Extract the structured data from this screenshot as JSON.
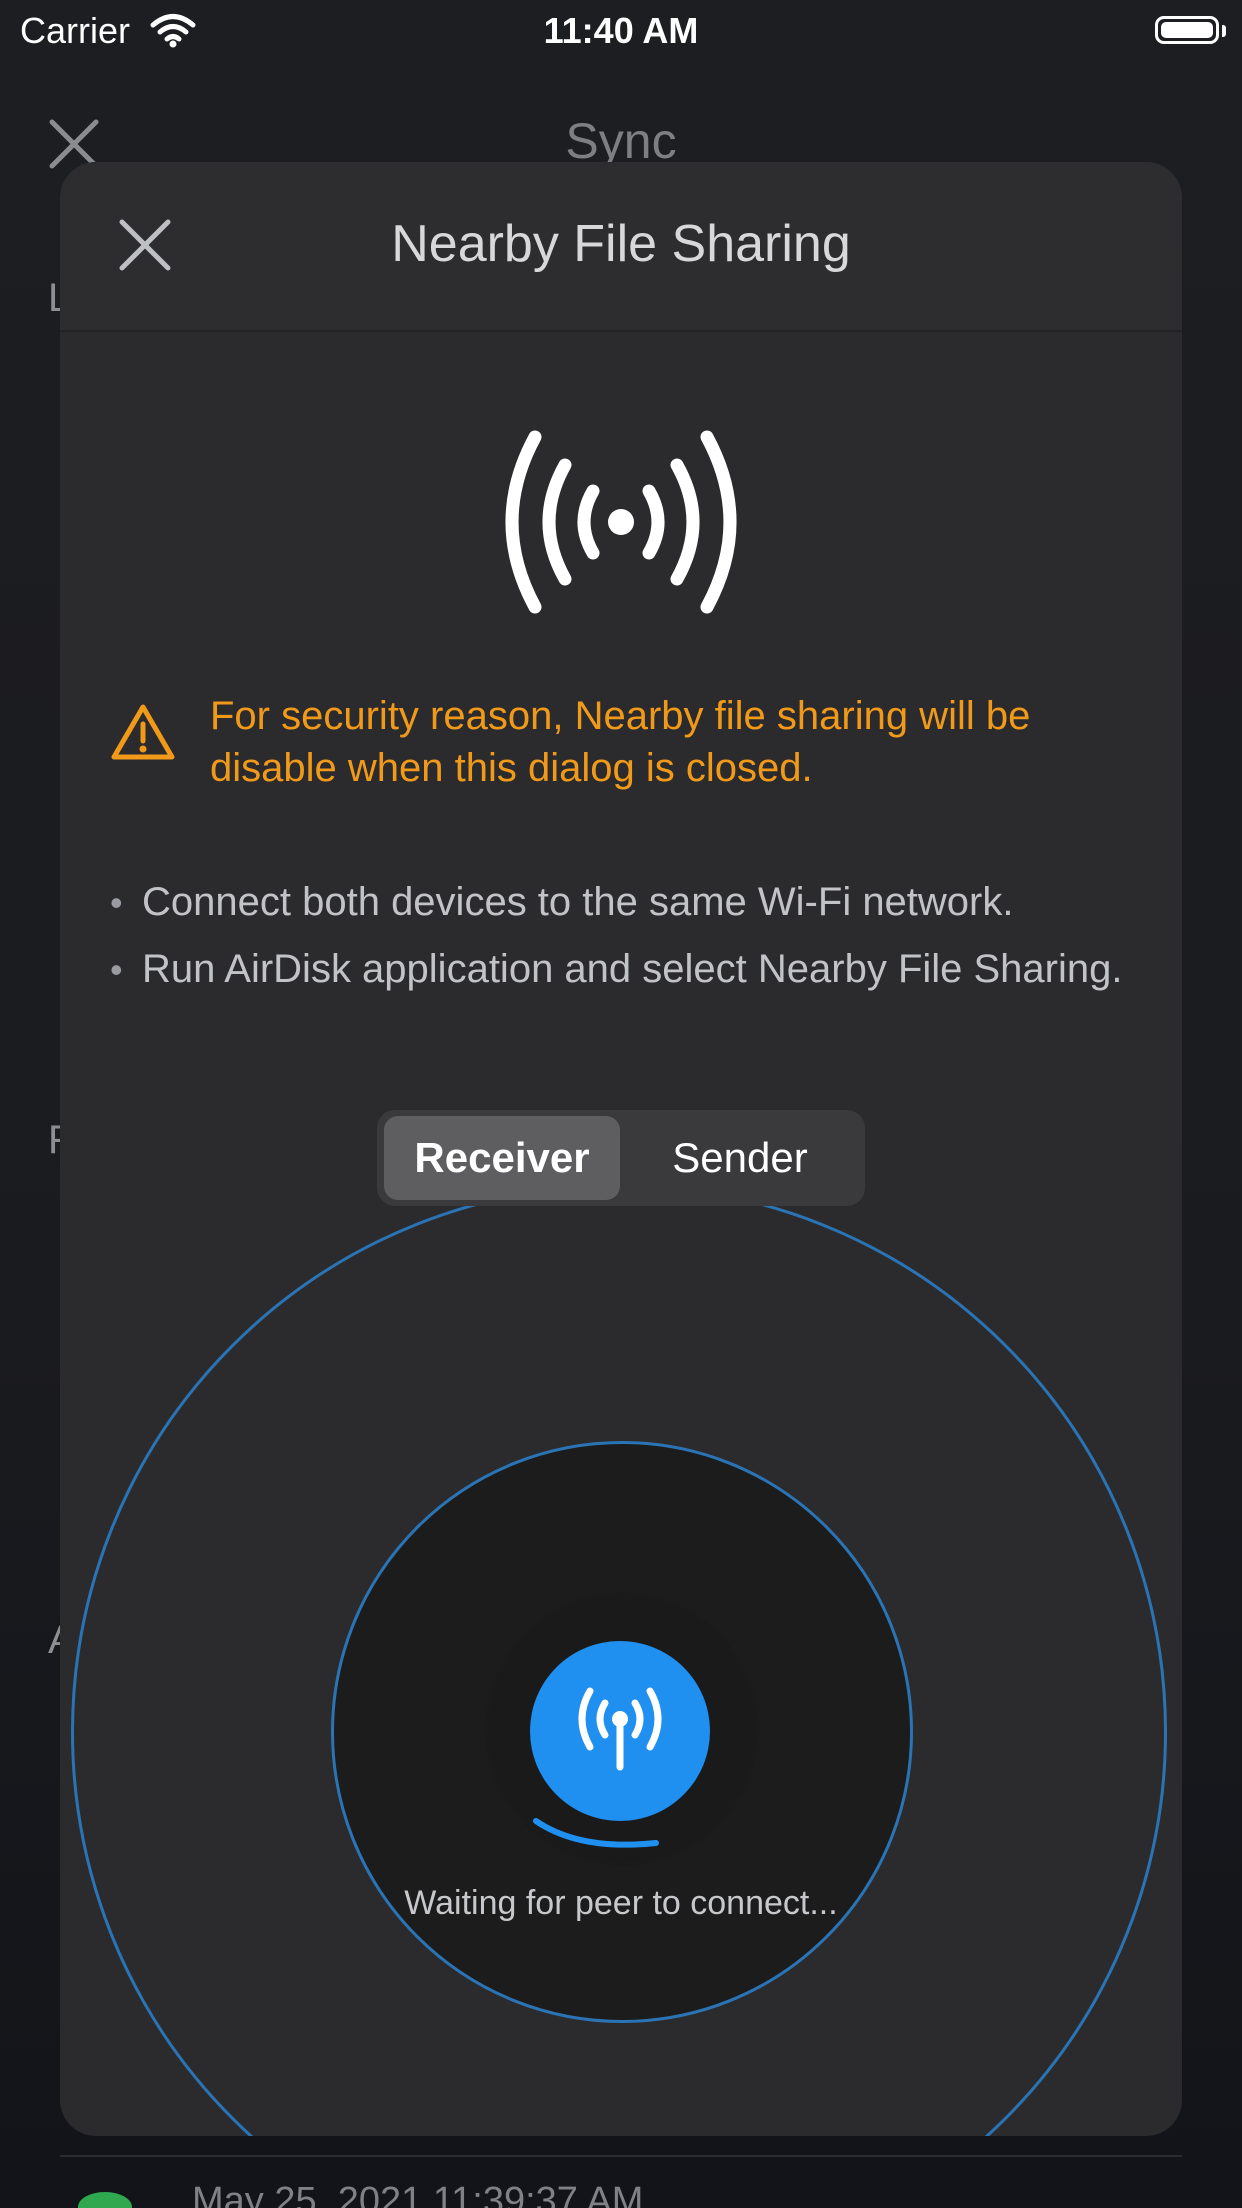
{
  "status_bar": {
    "carrier": "Carrier",
    "time": "11:40 AM"
  },
  "background": {
    "title": "Sync",
    "section_letters": [
      "L",
      "F",
      "A"
    ],
    "row_date": "May 25, 2021 11:39:37 AM"
  },
  "dialog": {
    "title": "Nearby File Sharing",
    "warning": "For security reason, Nearby file sharing will be disable when this dialog is closed.",
    "instructions": [
      "Connect both devices to the same Wi-Fi network.",
      "Run AirDisk application and select Nearby File Sharing."
    ],
    "modes": {
      "receiver": "Receiver",
      "sender": "Sender",
      "selected": "Receiver"
    },
    "status": "Waiting for peer to connect..."
  },
  "colors": {
    "warning": "#f19a1a",
    "accent": "#1f8ff0",
    "radar_ring": "#2a74b5"
  },
  "icons": [
    "close-icon",
    "broadcast-icon",
    "warning-icon",
    "antenna-icon",
    "wifi-icon",
    "battery-icon"
  ]
}
